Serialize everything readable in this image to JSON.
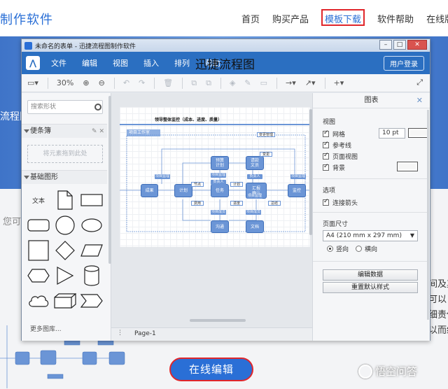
{
  "site": {
    "logo": "制作软件",
    "nav": [
      "首页",
      "购买产品",
      "模板下载",
      "软件帮助",
      "在线版"
    ],
    "active_nav": "模板下载",
    "banner_text": "流程图",
    "left_text": "您可",
    "right_lines": [
      "间及其",
      "可以",
      "细责任",
      "以而结"
    ],
    "online_edit_button": "在线编辑",
    "watermark": "悟空问答"
  },
  "window": {
    "title": "未命名的表单 - 迅捷流程图制作软件",
    "controls": [
      "–",
      "□",
      "✕"
    ],
    "menu": [
      "文件",
      "编辑",
      "视图",
      "插入",
      "排列",
      "帮助"
    ],
    "brand": "迅捷流程图",
    "login": "用户登录",
    "toolbar": {
      "zoom": "30%",
      "buttons": [
        "▭▾",
        "⊕",
        "⊖",
        "↶",
        "↷",
        "🗑",
        "⧉",
        "⧉",
        "◈",
        "✎",
        "▭",
        "→▾",
        "↗▾",
        "+▾"
      ],
      "fullscreen": "⤢"
    }
  },
  "shapes_panel": {
    "search_placeholder": "搜索形状",
    "scratchpad_title": "便条簿",
    "scratchpad_tools": "✎ ✕",
    "drop_hint": "将元素拖到此处",
    "basic_title": "基础图形",
    "text_shape": "文本",
    "more_libraries": "更多图库..."
  },
  "canvas": {
    "diagram_title": "领导整体监控（成本、进度、质量）",
    "lane_label": "项目工作室",
    "nodes": [
      "成果",
      "计划",
      "任务",
      "汇报\n确认",
      "监控",
      "预算\n计划",
      "请款\n文员",
      "沟通",
      "文档"
    ],
    "labels": [
      "项目监理",
      "项目监理",
      "负责人",
      "负责人",
      "项目监理",
      "项目成员",
      "项目成员",
      "项目监理"
    ],
    "notes": [
      "节点",
      "费用",
      "计划",
      "进度",
      "变更管理",
      "变更",
      "总结"
    ],
    "page_tab": "Page-1"
  },
  "props_panel": {
    "title": "图表",
    "view_section": "视图",
    "grid": "网格",
    "grid_size": "10 pt",
    "guides": "参考线",
    "page_view": "页面视图",
    "background": "背景",
    "options_section": "选项",
    "connection_arrows": "连接箭头",
    "page_size_section": "页面尺寸",
    "paper": "A4 (210 mm x 297 mm)",
    "portrait": "竖向",
    "landscape": "横向",
    "edit_data": "编辑数据",
    "reset_style": "重置默认样式"
  },
  "colors": {
    "brand_blue": "#2b6fc1",
    "highlight_red": "#e0262b",
    "node_blue": "#6b95d6"
  }
}
